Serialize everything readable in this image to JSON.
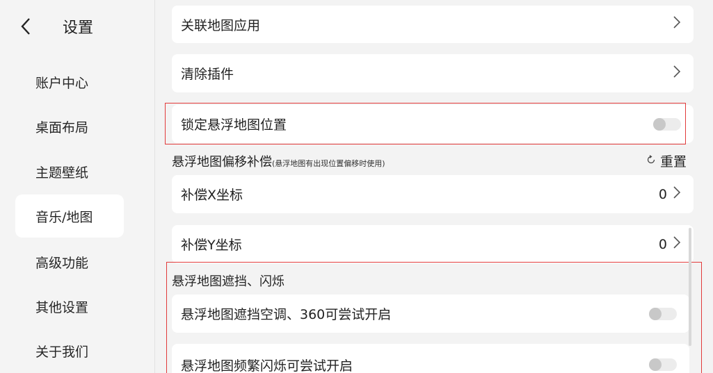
{
  "header": {
    "back_icon": "chevron-left-icon",
    "title": "设置"
  },
  "sidebar": {
    "items": [
      {
        "label": "账户中心"
      },
      {
        "label": "桌面布局"
      },
      {
        "label": "主题壁纸"
      },
      {
        "label": "音乐/地图",
        "active": true
      },
      {
        "label": "高级功能"
      },
      {
        "label": "其他设置"
      },
      {
        "label": "关于我们"
      }
    ]
  },
  "content": {
    "link_map_app": {
      "label": "关联地图应用"
    },
    "clear_plugin": {
      "label": "清除插件"
    },
    "lock_float_map": {
      "label": "锁定悬浮地图位置",
      "toggle_on": false
    },
    "offset_section": {
      "title": "悬浮地图偏移补偿",
      "subtitle": "(悬浮地图有出现位置偏移时使用)",
      "reset_label": "重置",
      "reset_icon": "refresh-icon"
    },
    "offset_x": {
      "label": "补偿X坐标",
      "value": "0"
    },
    "offset_y": {
      "label": "补偿Y坐标",
      "value": "0"
    },
    "flicker_section": {
      "title": "悬浮地图遮挡、闪烁"
    },
    "ac_occlusion": {
      "label": "悬浮地图遮挡空调、360可尝试开启",
      "toggle_on": false
    },
    "frequent_flicker": {
      "label": "悬浮地图频繁闪烁可尝试开启",
      "toggle_on": false
    }
  },
  "colors": {
    "highlight_border": "#e23a3a",
    "page_bg": "#f3f3f3",
    "card_bg": "#ffffff"
  }
}
